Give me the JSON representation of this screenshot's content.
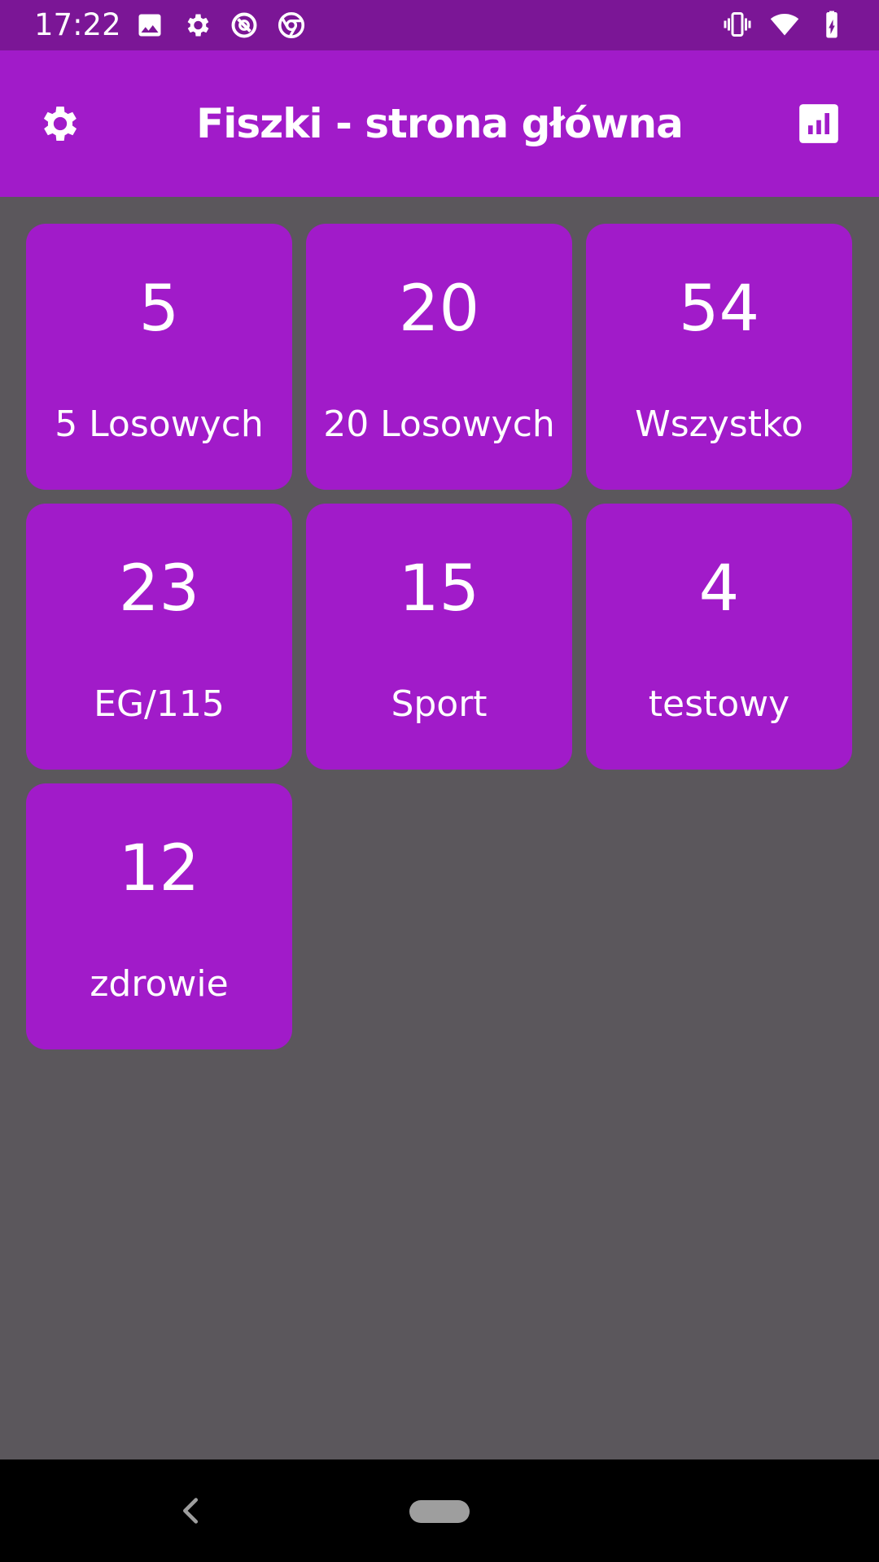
{
  "status_bar": {
    "time": "17:22",
    "left_icons": [
      "image-icon",
      "gear-icon",
      "data-saver-icon",
      "chrome-icon"
    ],
    "right_icons": [
      "vibrate-icon",
      "wifi-icon",
      "battery-charging-icon"
    ]
  },
  "app_bar": {
    "title": "Fiszki - strona główna",
    "left_action_icon": "gear-icon",
    "right_action_icon": "bar-chart-icon"
  },
  "tiles": [
    {
      "count": "5",
      "label": "5 Losowych"
    },
    {
      "count": "20",
      "label": "20 Losowych"
    },
    {
      "count": "54",
      "label": "Wszystko"
    },
    {
      "count": "23",
      "label": "EG/115"
    },
    {
      "count": "15",
      "label": "Sport"
    },
    {
      "count": "4",
      "label": "testowy"
    },
    {
      "count": "12",
      "label": "zdrowie"
    }
  ],
  "colors": {
    "status_bar": "#7b1696",
    "app_bar": "#a11bc9",
    "tile": "#a11bc9",
    "background": "#5b575c",
    "nav_bar": "#000000"
  },
  "nav_bar": {
    "back_icon": "back-chevron-icon",
    "home_icon": "home-pill-icon"
  }
}
